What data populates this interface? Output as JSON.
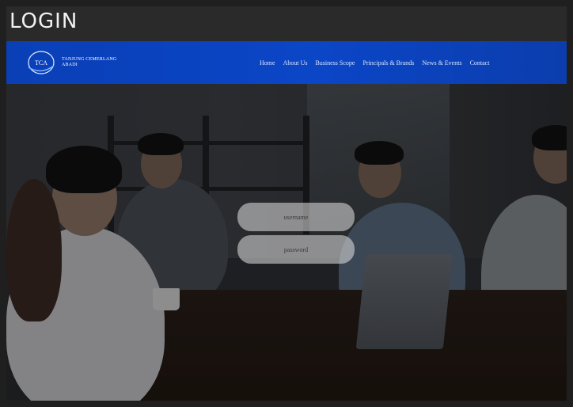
{
  "page": {
    "title": "LOGIN"
  },
  "navbar": {
    "brand": {
      "logo_text": "TCA",
      "name_line1": "TANJUNG CEMERLANG",
      "name_line2": "ABADI"
    },
    "items": [
      {
        "label": "Home"
      },
      {
        "label": "About Us"
      },
      {
        "label": "Business Scope"
      },
      {
        "label": "Principals & Brands"
      },
      {
        "label": "News & Events"
      },
      {
        "label": "Contact"
      }
    ]
  },
  "login_form": {
    "username_placeholder": "username",
    "password_placeholder": "password"
  },
  "colors": {
    "navbar": "#0b46c7",
    "background": "#1f1f1f",
    "field": "#e1e1e1"
  }
}
